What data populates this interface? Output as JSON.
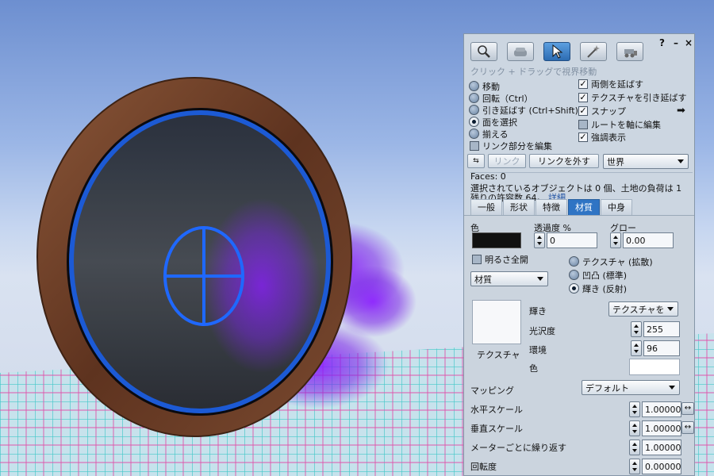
{
  "window": {
    "help_label": "?",
    "minimize_label": "–",
    "close_label": "×"
  },
  "toolbar": {
    "tools": [
      {
        "name": "focus-tool",
        "icon": "magnifier-icon"
      },
      {
        "name": "move-tool",
        "icon": "hand-icon"
      },
      {
        "name": "edit-tool",
        "icon": "arrow-cursor-icon",
        "active": true
      },
      {
        "name": "create-tool",
        "icon": "wand-icon"
      },
      {
        "name": "land-tool",
        "icon": "bulldozer-icon"
      }
    ],
    "hint": "クリック + ドラッグで視界移動"
  },
  "edit_modes": {
    "move": "移動",
    "rotate": "回転（Ctrl）",
    "stretch": "引き延ばす (Ctrl+Shift)",
    "select_face": "面を選択",
    "align": "揃える",
    "selected": "select_face"
  },
  "options": {
    "stretch_both_sides": {
      "label": "両側を延ばす",
      "checked": true
    },
    "stretch_textures": {
      "label": "テクスチャを引き延ばす",
      "checked": true
    },
    "snap": {
      "label": "スナップ",
      "checked": true
    },
    "edit_root_axis": {
      "label": "ルートを軸に編集",
      "checked": false
    },
    "highlight": {
      "label": "強調表示",
      "checked": true
    },
    "edit_linked": {
      "label": "リンク部分を編集",
      "checked": false
    }
  },
  "link_bar": {
    "link_label": "リンク",
    "unlink_label": "リンクを外す",
    "ruler_value": "世界"
  },
  "info": {
    "faces": "Faces: 0",
    "selection_text": "選択されているオブジェクトは 0 個、土地の負荷は 1",
    "remaining_text": "残りの許容数 64。",
    "details_link": "詳細"
  },
  "tabs": [
    {
      "label": "一般",
      "active": false
    },
    {
      "label": "形状",
      "active": false
    },
    {
      "label": "特徴",
      "active": false
    },
    {
      "label": "材質",
      "active": true
    },
    {
      "label": "中身",
      "active": false
    }
  ],
  "texture_tab": {
    "color_label": "色",
    "color_value": "#111111",
    "transparency_label": "透過度 %",
    "transparency_value": "0",
    "glow_label": "グロー",
    "glow_value": "0.00",
    "fullbright_label": "明るさ全開",
    "fullbright_checked": false,
    "material_combo": "材質",
    "map_modes": {
      "diffuse": "テクスチャ (拡散)",
      "normal": "凹凸 (標準)",
      "specular": "輝き (反射)",
      "selected": "specular"
    },
    "shininess_label": "輝き",
    "shininess_value": "テクスチャを",
    "glossiness_label": "光沢度",
    "glossiness_value": "255",
    "environment_label": "環境",
    "environment_value": "96",
    "spec_color_label": "色",
    "spec_color_value": "#ffffff",
    "texture_label": "テクスチャ",
    "mapping_label": "マッピング",
    "mapping_value": "デフォルト",
    "h_scale_label": "水平スケール",
    "h_scale_value": "1.00000",
    "v_scale_label": "垂直スケール",
    "v_scale_value": "1.00000",
    "repeats_label": "メーターごとに繰り返す",
    "repeats_value": "1.00000",
    "rotation_label": "回転度",
    "rotation_value": "0.00000"
  },
  "colors": {
    "panel_bg": "#ccd6e1",
    "accent": "#2f74c4",
    "frame_wood": "#6b3d26",
    "face_glow": "#1e5fe0",
    "particles": "#7a1fe0"
  }
}
